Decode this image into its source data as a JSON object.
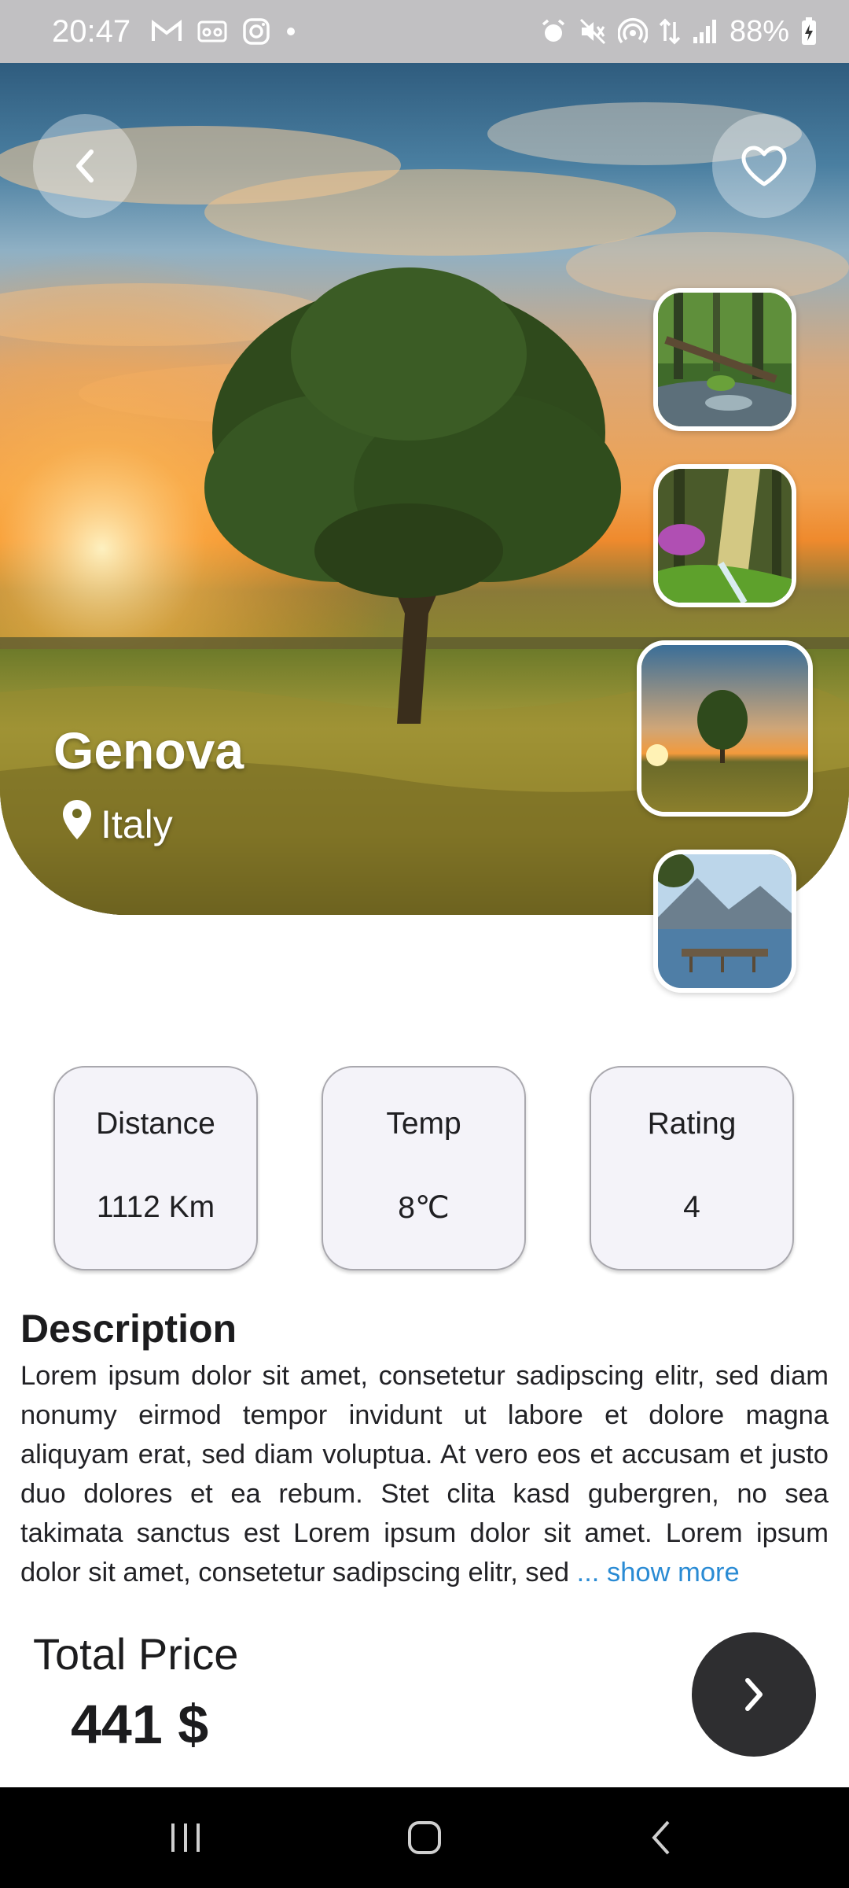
{
  "status_bar": {
    "time": "20:47",
    "battery": "88%",
    "left_icons": [
      "gmail-icon",
      "voicemail-icon",
      "instagram-icon",
      "dot-icon"
    ],
    "right_icons": [
      "alarm-icon",
      "mute-icon",
      "hotspot-icon",
      "data-icon",
      "signal-icon",
      "battery-icon"
    ]
  },
  "hero": {
    "title": "Genova",
    "location": "Italy"
  },
  "stats": [
    {
      "label": "Distance",
      "value": "1112 Km"
    },
    {
      "label": "Temp",
      "value": "8℃"
    },
    {
      "label": "Rating",
      "value": "4"
    }
  ],
  "description": {
    "title": "Description",
    "text": "Lorem ipsum dolor sit amet, consetetur sadipscing elitr, sed diam nonumy eirmod tempor invidunt ut labore et dolore magna aliquyam erat, sed diam voluptua. At vero eos et accusam et justo duo dolores et ea rebum. Stet clita kasd gubergren, no sea takimata sanctus est Lorem ipsum dolor sit amet. Lorem ipsum dolor sit amet, consetetur sadipscing elitr, sed",
    "show_more": "... show more"
  },
  "price": {
    "label": "Total Price",
    "value": "441 $"
  },
  "colors": {
    "link": "#2a8bd4",
    "card_bg": "#f4f3f9",
    "button_dark": "#2e2e30"
  }
}
